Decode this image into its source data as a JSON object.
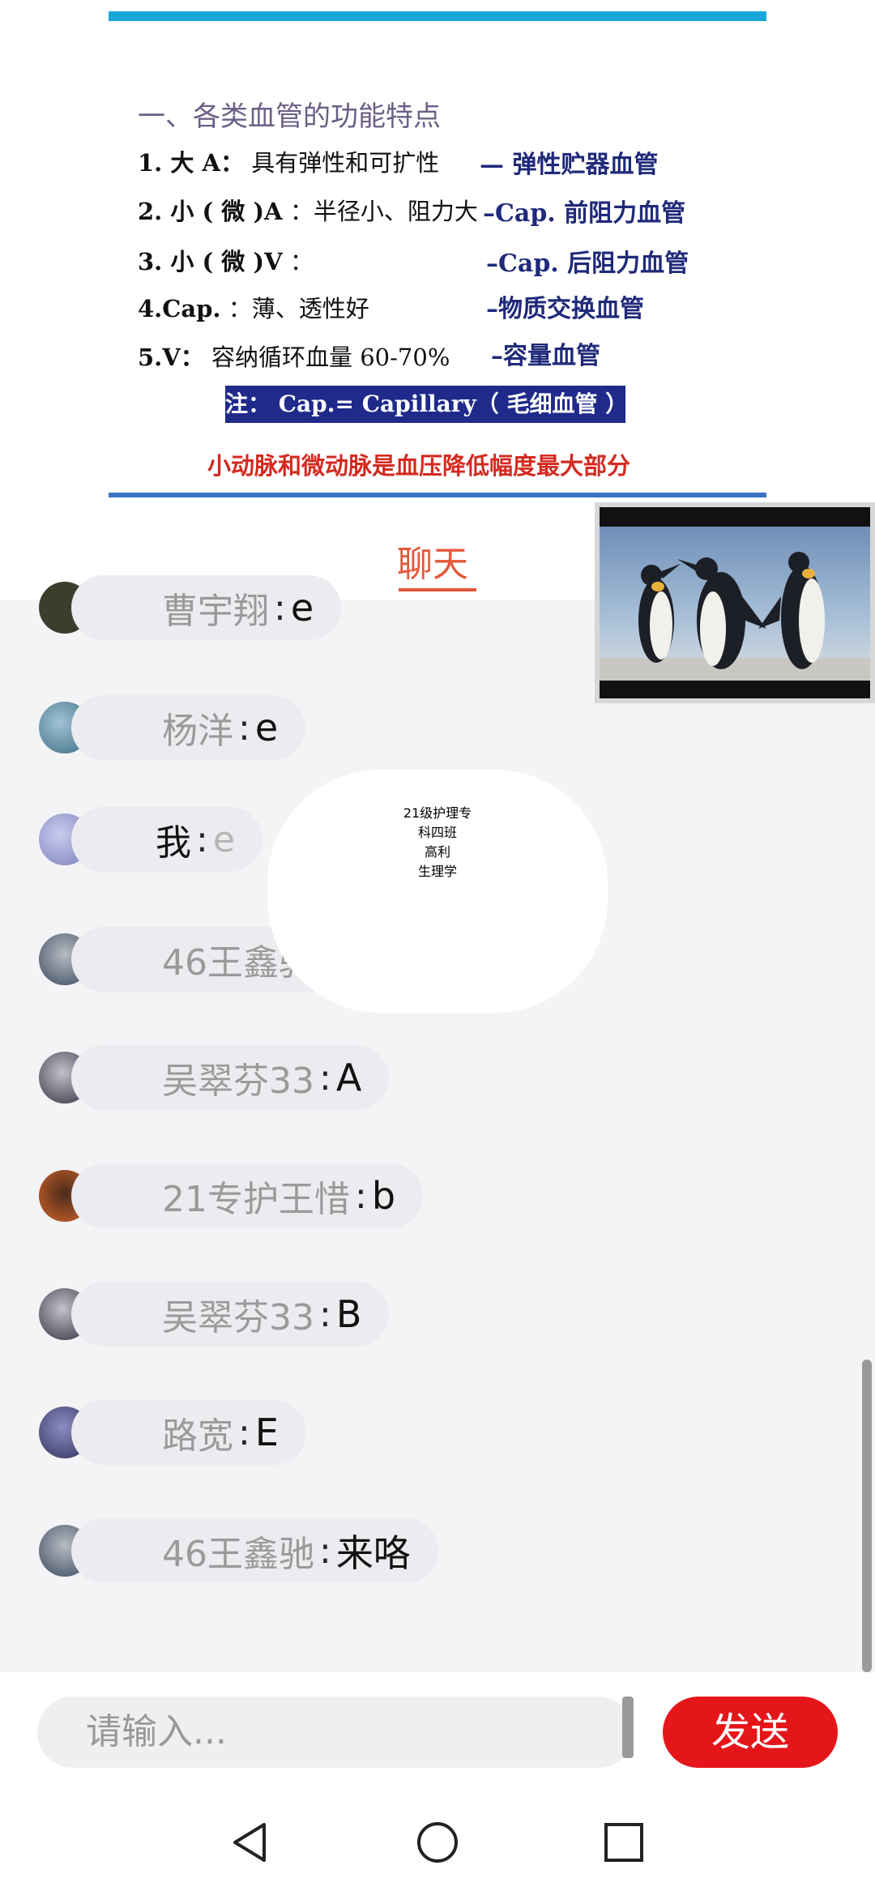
{
  "slide": {
    "title": "一、各类血管的功能特点",
    "rows": [
      {
        "label": "1. 大 A：",
        "desc": "具有弹性和可扩性",
        "right": "— 弹性贮器血管"
      },
      {
        "label": "2. 小 ( 微 )A",
        "desc": "：半径小、阻力大",
        "right": "–Cap. 前阻力血管"
      },
      {
        "label": "3. 小 ( 微 )V",
        "desc": "：",
        "right": "–Cap. 后阻力血管"
      },
      {
        "label": "4.Cap.",
        "desc": "：薄、透性好",
        "right": "–物质交换血管"
      },
      {
        "label": "5.V：",
        "desc": "容纳循环血量 60-70%",
        "right": "–容量血管"
      }
    ],
    "note": "注：  Cap.= Capillary（ 毛细血管 ）",
    "red_note": "小动脉和微动脉是血压降低幅度最大部分"
  },
  "chat": {
    "tab_label": "聊天",
    "messages": [
      {
        "name": "曹宇翔",
        "sep": ":",
        "text": "e",
        "avatar_color": "#3a3f2c"
      },
      {
        "name": "杨洋",
        "sep": ":",
        "text": "e",
        "avatar_color": "#5a8a9e"
      },
      {
        "name": "我",
        "sep": ":",
        "text": "e",
        "avatar_color": "#8f93c9",
        "is_self": true
      },
      {
        "name": "46王鑫驰",
        "sep": "",
        "text": "",
        "avatar_color": "#4c5a6e"
      },
      {
        "name": "吴翠芬33",
        "sep": ":",
        "text": "A",
        "avatar_color": "#3d3d52"
      },
      {
        "name": "21专护王惜",
        "sep": ":",
        "text": "b",
        "avatar_color": "#b4552d"
      },
      {
        "name": "吴翠芬33",
        "sep": ":",
        "text": "B",
        "avatar_color": "#3d3d52"
      },
      {
        "name": "路宽",
        "sep": ":",
        "text": "E",
        "avatar_color": "#4a4a7a"
      },
      {
        "name": "46王鑫驰",
        "sep": ":",
        "text": "来咯",
        "avatar_color": "#4c5a6e"
      }
    ]
  },
  "watermark": {
    "lines": [
      "21级护理专",
      "科四班",
      "高利",
      "生理学"
    ]
  },
  "input": {
    "placeholder": "请输入...",
    "send_label": "发送"
  },
  "colors": {
    "accent": "#e5573b",
    "send": "#e4161a",
    "slide_blue": "#1f2a7a",
    "slide_red": "#d42a20"
  },
  "icons": {
    "nav_back": "back-triangle-icon",
    "nav_home": "home-circle-icon",
    "nav_recents": "recents-square-icon"
  }
}
